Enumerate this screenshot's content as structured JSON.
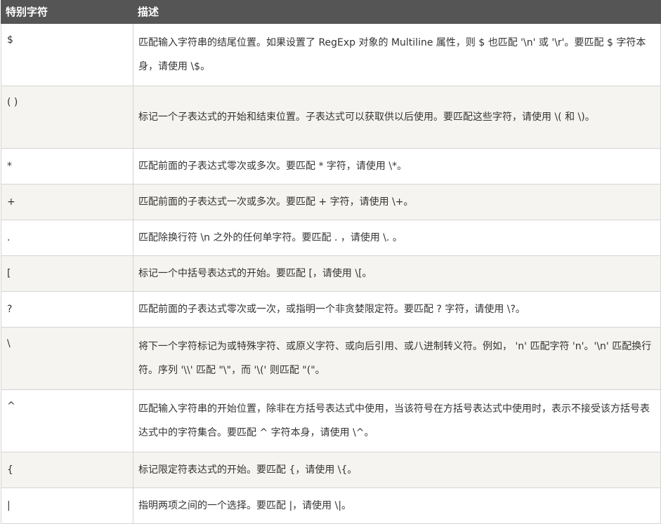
{
  "table": {
    "headers": [
      "特别字符",
      "描述"
    ],
    "rows": [
      {
        "char": "$",
        "desc": "匹配输入字符串的结尾位置。如果设置了 RegExp 对象的 Multiline 属性，则 $ 也匹配 '\\n' 或 '\\r'。要匹配 $ 字符本身，请使用 \\$。"
      },
      {
        "char": "( )",
        "desc": "标记一个子表达式的开始和结束位置。子表达式可以获取供以后使用。要匹配这些字符，请使用 \\( 和 \\)。"
      },
      {
        "char": "*",
        "desc": "匹配前面的子表达式零次或多次。要匹配 * 字符，请使用 \\*。"
      },
      {
        "char": "+",
        "desc": "匹配前面的子表达式一次或多次。要匹配 + 字符，请使用 \\+。"
      },
      {
        "char": ".",
        "desc": "匹配除换行符 \\n 之外的任何单字符。要匹配 . ，请使用 \\. 。"
      },
      {
        "char": "[",
        "desc": "标记一个中括号表达式的开始。要匹配 [，请使用 \\[。"
      },
      {
        "char": "?",
        "desc": "匹配前面的子表达式零次或一次，或指明一个非贪婪限定符。要匹配 ? 字符，请使用 \\?。"
      },
      {
        "char": "\\",
        "desc": "将下一个字符标记为或特殊字符、或原义字符、或向后引用、或八进制转义符。例如， 'n' 匹配字符 'n'。'\\n' 匹配换行符。序列 '\\\\' 匹配 \"\\\"，而 '\\(' 则匹配 \"(\"。"
      },
      {
        "char": "^",
        "desc": "匹配输入字符串的开始位置，除非在方括号表达式中使用，当该符号在方括号表达式中使用时，表示不接受该方括号表达式中的字符集合。要匹配 ^ 字符本身，请使用 \\^。"
      },
      {
        "char": "{",
        "desc": "标记限定符表达式的开始。要匹配 {，请使用 \\{。"
      },
      {
        "char": "|",
        "desc": "指明两项之间的一个选择。要匹配 |，请使用 \\|。"
      }
    ]
  }
}
